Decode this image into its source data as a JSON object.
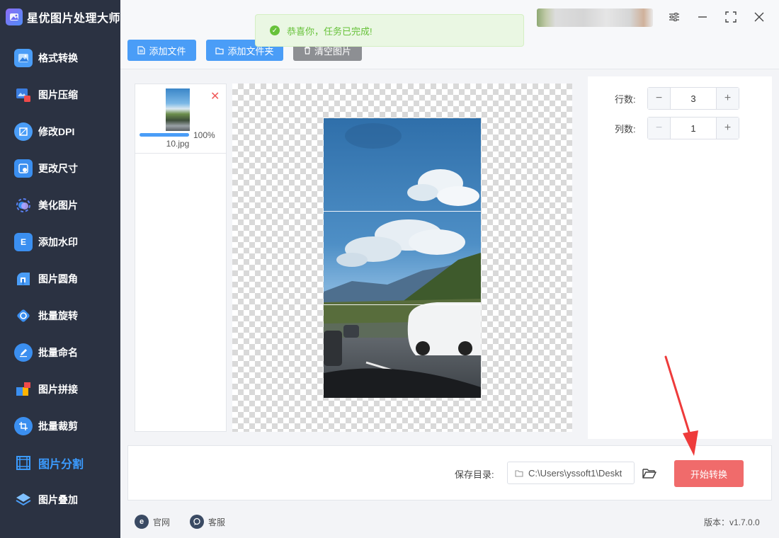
{
  "app": {
    "title": "星优图片处理大师"
  },
  "sidebar": {
    "items": [
      {
        "label": "格式转换",
        "icon": "image-convert-icon",
        "color": "#4a9df7"
      },
      {
        "label": "图片压缩",
        "icon": "image-compress-icon",
        "color": "#3b7de0"
      },
      {
        "label": "修改DPI",
        "icon": "dpi-icon",
        "color": "#4a9df7"
      },
      {
        "label": "更改尺寸",
        "icon": "resize-icon",
        "color": "#3b8ff0"
      },
      {
        "label": "美化图片",
        "icon": "beautify-icon",
        "color": "#5a7ff0"
      },
      {
        "label": "添加水印",
        "icon": "watermark-icon",
        "color": "#3b8ff0"
      },
      {
        "label": "图片圆角",
        "icon": "round-corner-icon",
        "color": "#4a9df7"
      },
      {
        "label": "批量旋转",
        "icon": "rotate-icon",
        "color": "#3b8ff0"
      },
      {
        "label": "批量命名",
        "icon": "rename-icon",
        "color": "#3b8ff0"
      },
      {
        "label": "图片拼接",
        "icon": "puzzle-icon",
        "color": "#3b8ff0"
      },
      {
        "label": "批量裁剪",
        "icon": "crop-icon",
        "color": "#3b8ff0"
      },
      {
        "label": "图片分割",
        "icon": "split-grid-icon",
        "color": "#3b9bff",
        "active": true
      },
      {
        "label": "图片叠加",
        "icon": "layers-icon",
        "color": "#4a9df7"
      }
    ]
  },
  "toolbar": {
    "add_file": "添加文件",
    "add_folder": "添加文件夹",
    "clear": "清空图片"
  },
  "toast": {
    "message": "恭喜你，任务已完成!"
  },
  "file_list": [
    {
      "name": "10.jpg",
      "progress_pct": 100,
      "progress_label": "100%"
    }
  ],
  "settings": {
    "rows_label": "行数:",
    "rows_value": "3",
    "cols_label": "列数:",
    "cols_value": "1"
  },
  "save": {
    "label": "保存目录:",
    "path": "C:\\Users\\yssoft1\\Deskt",
    "start_button": "开始转换"
  },
  "footer": {
    "website": "官网",
    "support": "客服",
    "version": "版本：v1.7.0.0"
  },
  "colors": {
    "primary": "#4a9df7",
    "danger": "#f06b6b",
    "sidebar_bg": "#2b3242",
    "success": "#67c23a"
  }
}
